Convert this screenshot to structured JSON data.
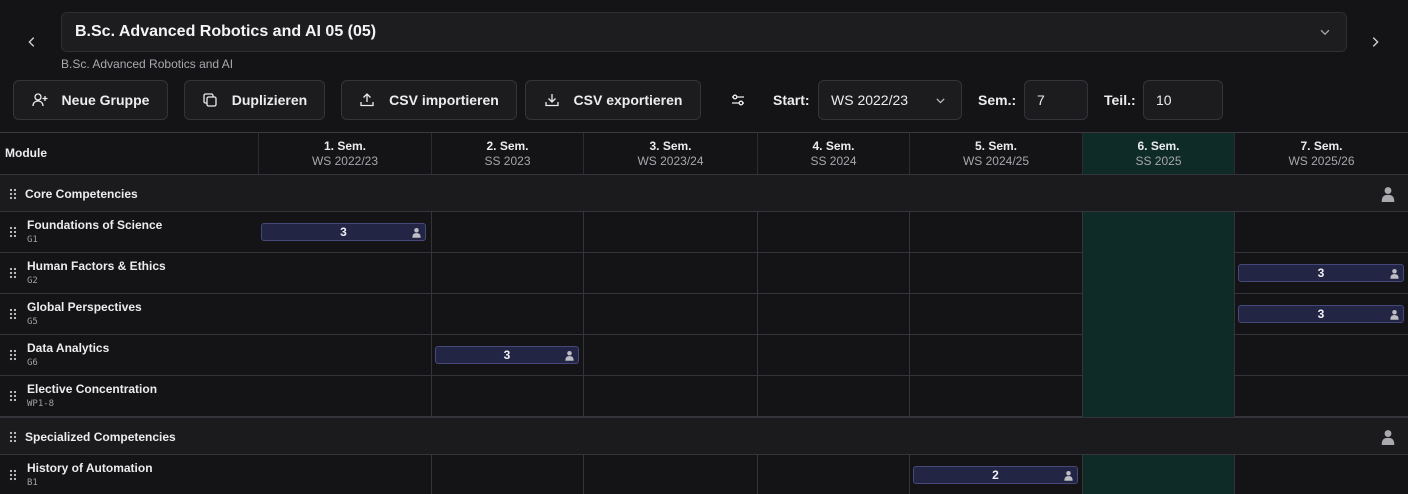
{
  "program": {
    "title": "B.Sc. Advanced Robotics and AI 05 (05)",
    "subtitle": "B.Sc. Advanced Robotics and AI"
  },
  "toolbar": {
    "new_group": "Neue Gruppe",
    "duplicate": "Duplizieren",
    "csv_import": "CSV importieren",
    "csv_export": "CSV exportieren",
    "start_label": "Start:",
    "start_value": "WS 2022/23",
    "sem_label": "Sem.:",
    "sem_value": "7",
    "teil_label": "Teil.:",
    "teil_value": "10"
  },
  "grid": {
    "module_header": "Module",
    "semesters": [
      {
        "label": "1. Sem.",
        "term": "WS 2022/23"
      },
      {
        "label": "2. Sem.",
        "term": "SS 2023"
      },
      {
        "label": "3. Sem.",
        "term": "WS 2023/24"
      },
      {
        "label": "4. Sem.",
        "term": "SS 2024"
      },
      {
        "label": "5. Sem.",
        "term": "WS 2024/25"
      },
      {
        "label": "6. Sem.",
        "term": "SS 2025"
      },
      {
        "label": "7. Sem.",
        "term": "WS 2025/26"
      }
    ],
    "highlight_semester": 6,
    "groups": [
      {
        "name": "Core Competencies",
        "modules": [
          {
            "name": "Foundations of Science",
            "code": "G1",
            "semester": 1,
            "credits": "3"
          },
          {
            "name": "Human Factors & Ethics",
            "code": "G2",
            "semester": 7,
            "credits": "3"
          },
          {
            "name": "Global Perspectives",
            "code": "G5",
            "semester": 7,
            "credits": "3"
          },
          {
            "name": "Data Analytics",
            "code": "G6",
            "semester": 2,
            "credits": "3"
          },
          {
            "name": "Elective Concentration",
            "code": "WP1-8",
            "semester": 0,
            "credits": ""
          }
        ]
      },
      {
        "name": "Specialized Competencies",
        "modules": [
          {
            "name": "History of Automation",
            "code": "B1",
            "semester": 5,
            "credits": "2"
          }
        ]
      }
    ]
  }
}
